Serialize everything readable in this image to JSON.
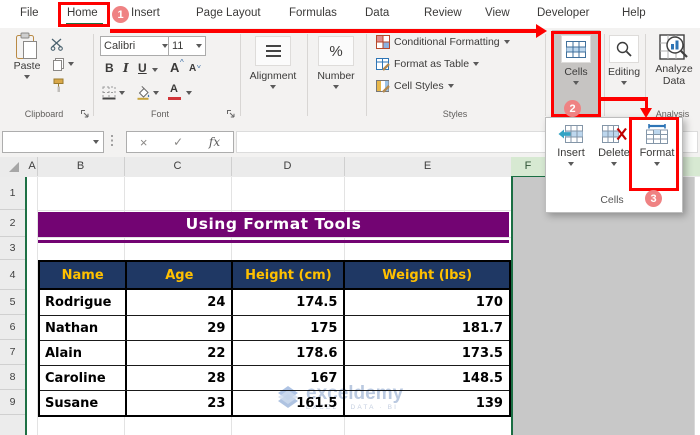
{
  "tabs": [
    "File",
    "Home",
    "Insert",
    "Page Layout",
    "Formulas",
    "Data",
    "Review",
    "View",
    "Developer",
    "Help"
  ],
  "annotations": {
    "step1": "1",
    "step2": "2",
    "step3": "3"
  },
  "ribbon": {
    "paste_label": "Paste",
    "font_name": "Calibri",
    "font_size": "11",
    "bold": "B",
    "italic": "I",
    "underline": "U",
    "letter": "A",
    "alignment_label": "Alignment",
    "number_label": "Number",
    "percent": "%",
    "conditional_formatting": "Conditional Formatting",
    "format_as_table": "Format as Table",
    "cell_styles": "Cell Styles",
    "cells_label": "Cells",
    "editing_label": "Editing",
    "analyze_label_1": "Analyze",
    "analyze_label_2": "Data",
    "group_clipboard": "Clipboard",
    "group_font": "Font",
    "group_styles": "Styles",
    "group_analysis": "Analysis"
  },
  "formula_bar": {
    "name_value": "",
    "cancel": "×",
    "enter": "✓",
    "fx": "fx",
    "formula_value": ""
  },
  "cells_menu": {
    "insert": "Insert",
    "delete": "Delete",
    "format": "Format",
    "group_label": "Cells"
  },
  "grid": {
    "columns": [
      "A",
      "B",
      "C",
      "D",
      "E",
      "F"
    ],
    "rows": [
      "1",
      "2",
      "3",
      "4",
      "5",
      "6",
      "7",
      "8",
      "9"
    ]
  },
  "sheet": {
    "title": "Using Format Tools",
    "table_headers": [
      "Name",
      "Age",
      "Height (cm)",
      "Weight (lbs)"
    ],
    "table_rows": [
      [
        "Rodrigue",
        "24",
        "174.5",
        "170"
      ],
      [
        "Nathan",
        "29",
        "175",
        "181.7"
      ],
      [
        "Alain",
        "22",
        "178.6",
        "173.5"
      ],
      [
        "Caroline",
        "28",
        "167",
        "148.5"
      ],
      [
        "Susane",
        "23",
        "161.5",
        "139"
      ]
    ],
    "watermark_brand": "exceldemy",
    "watermark_tagline": "EXCEL · DATA · BI"
  },
  "colors": {
    "annotation_red": "#fe0000",
    "badge_pink": "#ef8283",
    "excel_green": "#1e7145",
    "title_purple": "#730473",
    "header_navy": "#1f3864",
    "header_gold": "#ffc000",
    "selection_gray": "#c8c8c8"
  }
}
